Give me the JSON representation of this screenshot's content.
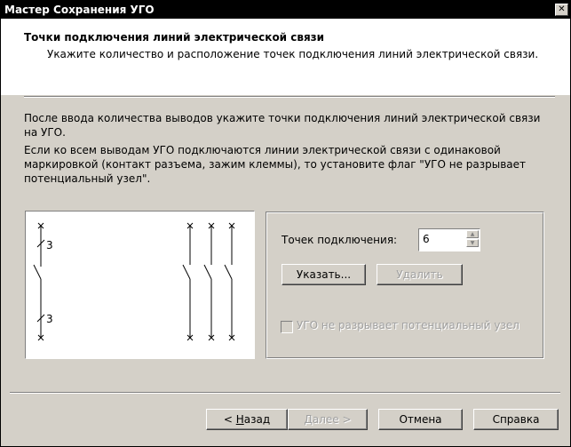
{
  "window": {
    "title": "Мастер Сохранения УГО",
    "close_glyph": "✕"
  },
  "header": {
    "title": "Точки подключения линий электрической связи",
    "subtitle": "Укажите количество и расположение точек подключения линий электрической связи."
  },
  "body": {
    "paragraph1": "После ввода количества выводов укажите точки подключения линий электрической связи на УГО.",
    "paragraph2": "Если ко всем выводам УГО подключаются линии электрической связи с одинаковой маркировкой (контакт разъема, зажим клеммы), то установите флаг \"УГО не разрывает потенциальный узел\"."
  },
  "preview": {
    "label_top": "3",
    "label_bottom": "3"
  },
  "panel": {
    "points_label": "Точек подключения:",
    "points_value": "6",
    "specify_button": "Указать...",
    "delete_button": "Удалить",
    "checkbox_label": "УГО не разрывает потенциальный узел",
    "checkbox_checked": false
  },
  "footer": {
    "back_accel": "Н",
    "back_rest": "азад",
    "back_prefix": "< ",
    "next_button": "Далее >",
    "cancel_button": "Отмена",
    "help_button": "Справка"
  }
}
